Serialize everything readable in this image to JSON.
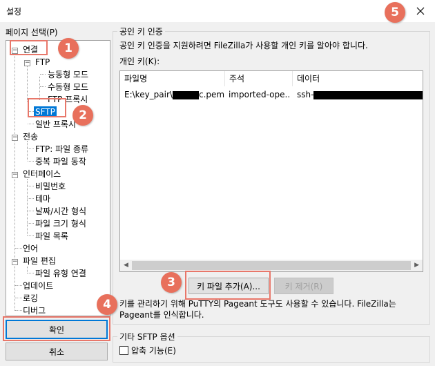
{
  "window": {
    "title": "설정"
  },
  "left": {
    "page_label": "페이지 선택(P)",
    "tree": [
      {
        "key": "connection",
        "label": "연결"
      },
      {
        "key": "ftp",
        "label": "FTP"
      },
      {
        "key": "active_mode",
        "label": "능동형 모드"
      },
      {
        "key": "passive_mode",
        "label": "수동형 모드"
      },
      {
        "key": "ftp_proxy",
        "label": "FTP 프록시"
      },
      {
        "key": "sftp",
        "label": "SFTP"
      },
      {
        "key": "generic_proxy",
        "label": "일반 프록시"
      },
      {
        "key": "transfers",
        "label": "전송"
      },
      {
        "key": "ftp_file_types",
        "label": "FTP: 파일 종류"
      },
      {
        "key": "duplicate_file_action",
        "label": "중복 파일 동작"
      },
      {
        "key": "interface",
        "label": "인터페이스"
      },
      {
        "key": "password",
        "label": "비밀번호"
      },
      {
        "key": "theme",
        "label": "테마"
      },
      {
        "key": "date_time_format",
        "label": "날짜/시간 형식"
      },
      {
        "key": "file_size_format",
        "label": "파일 크기 형식"
      },
      {
        "key": "file_lists",
        "label": "파일 목록"
      },
      {
        "key": "language",
        "label": "언어"
      },
      {
        "key": "file_editing",
        "label": "파일 편집"
      },
      {
        "key": "file_type_associations",
        "label": "파일 유형 연결"
      },
      {
        "key": "updates",
        "label": "업데이트"
      },
      {
        "key": "logging",
        "label": "로깅"
      },
      {
        "key": "debug",
        "label": "디버그"
      }
    ],
    "ok_label": "확인",
    "cancel_label": "취소"
  },
  "right": {
    "group_title": "공인 키 인증",
    "description": "공인 키 인증을 지원하려면 FileZilla가 사용할 개인 키를 알아야 합니다.",
    "private_keys_label": "개인 키(K):",
    "columns": [
      "파일명",
      "주석",
      "데이터"
    ],
    "rows": [
      {
        "filename_prefix": "E:\\key_pair\\",
        "filename_suffix": "c.pem",
        "comment": "imported-ope...",
        "data_prefix": "ssh-"
      }
    ],
    "add_key_label": "키 파일 추가(A)...",
    "remove_key_label": "키 제거(R)",
    "pageant_note": "키를 관리하기 위해 PuTTY의 Pageant 도구도 사용할 수 있습니다. FileZilla는 Pageant를 인식합니다.",
    "other_group_title": "기타 SFTP 옵션",
    "compression_label": "압축 기능(E)"
  },
  "annotations": [
    "1",
    "2",
    "3",
    "4",
    "5"
  ],
  "colors": {
    "accent": "#0078d7",
    "callout": "#e8705c"
  },
  "icons": {
    "close": "close-icon"
  }
}
